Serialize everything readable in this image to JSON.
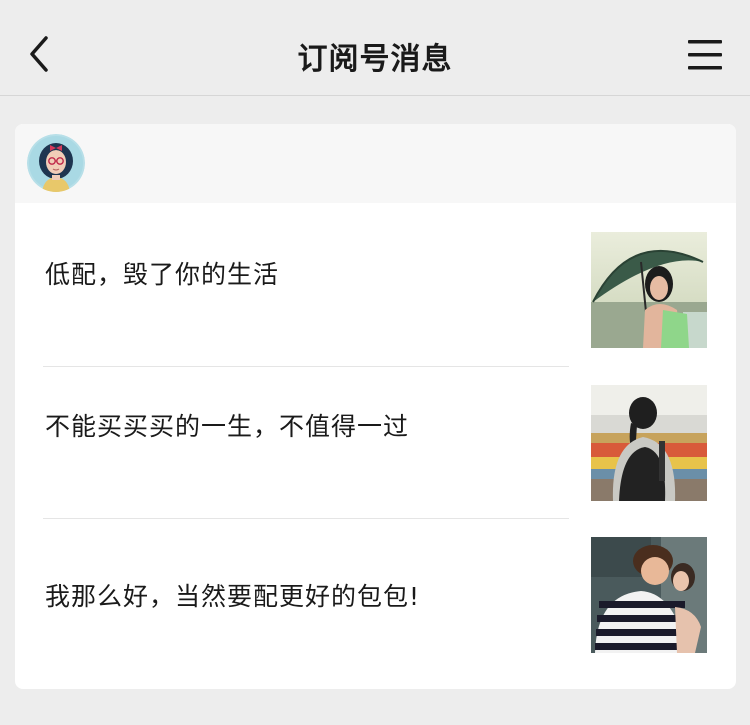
{
  "nav": {
    "title": "订阅号消息",
    "back_icon": "chevron-left-icon",
    "menu_icon": "hamburger-menu-icon"
  },
  "account": {
    "avatar_icon": "cartoon-girl-avatar"
  },
  "articles": [
    {
      "title": "低配，毁了你的生活",
      "thumbnail": "girl-with-umbrella-photo"
    },
    {
      "title": "不能买买买的一生，不值得一过",
      "thumbnail": "girl-with-backpack-photo"
    },
    {
      "title": "我那么好，当然要配更好的包包!",
      "thumbnail": "couple-hugging-photo"
    }
  ],
  "colors": {
    "background": "#ededed",
    "card": "#ffffff",
    "header_strip": "#f7f7f7",
    "text": "#1a1a1a"
  }
}
